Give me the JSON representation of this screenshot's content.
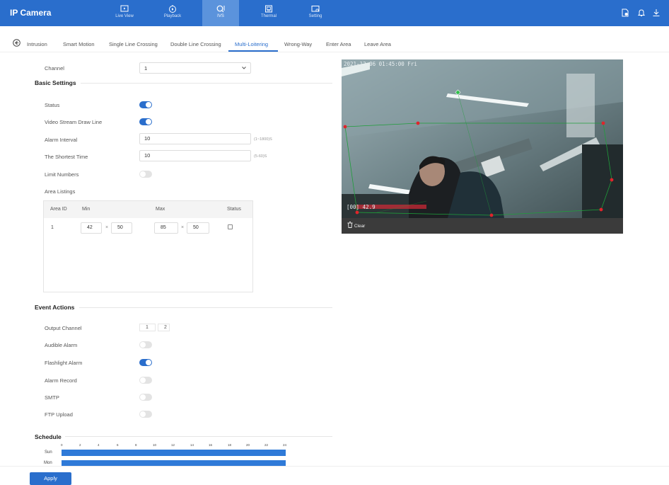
{
  "header": {
    "title": "IP Camera",
    "nav": [
      {
        "label": "Live View",
        "icon": "live-view-icon"
      },
      {
        "label": "Playback",
        "icon": "playback-icon"
      },
      {
        "label": "IVS",
        "icon": "ivs-icon"
      },
      {
        "label": "Thermal",
        "icon": "thermal-icon"
      },
      {
        "label": "Setting",
        "icon": "setting-icon"
      }
    ],
    "active_nav": "IVS"
  },
  "tabs": [
    "Intrusion",
    "Smart Motion",
    "Single Line Crossing",
    "Double Line Crossing",
    "Multi-Loitering",
    "Wrong-Way",
    "Enter Area",
    "Leave Area"
  ],
  "active_tab": "Multi-Loitering",
  "form": {
    "channel_label": "Channel",
    "channel_value": "1",
    "basic_settings": "Basic Settings",
    "status_label": "Status",
    "status_on": true,
    "draw_line_label": "Video Stream Draw Line",
    "draw_line_on": true,
    "alarm_interval_label": "Alarm Interval",
    "alarm_interval_value": "10",
    "alarm_interval_hint": "(1~1800)S",
    "shortest_time_label": "The Shortest Time",
    "shortest_time_value": "10",
    "shortest_time_hint": "(5-60)S",
    "limit_numbers_label": "Limit Numbers",
    "limit_numbers_on": false,
    "area_listings_label": "Area Listings"
  },
  "area_table": {
    "headers": [
      "Area ID",
      "Min",
      "Max",
      "Status"
    ],
    "rows": [
      {
        "id": "1",
        "min_w": "42",
        "min_h": "50",
        "max_w": "85",
        "max_h": "50",
        "times": "×"
      }
    ]
  },
  "events": {
    "title": "Event Actions",
    "output_channel_label": "Output Channel",
    "output_channels": [
      "1",
      "2"
    ],
    "audible_alarm_label": "Audible Alarm",
    "audible_alarm_on": false,
    "flashlight_alarm_label": "Flashlight Alarm",
    "flashlight_alarm_on": true,
    "alarm_record_label": "Alarm Record",
    "alarm_record_on": false,
    "smtp_label": "SMTP",
    "smtp_on": false,
    "ftp_label": "FTP Upload",
    "ftp_on": false
  },
  "schedule": {
    "title": "Schedule",
    "hours": [
      "0",
      "2",
      "4",
      "6",
      "8",
      "10",
      "12",
      "14",
      "16",
      "18",
      "20",
      "22",
      "24"
    ],
    "days": [
      "Sun",
      "Mon"
    ]
  },
  "apply_label": "Apply",
  "camera": {
    "timestamp": "2021-12-06 01:45:00 Fri",
    "osd_value": "[00] 42.9",
    "clear_label": "Clear"
  },
  "colors": {
    "accent": "#2a6ecc",
    "schedule_bar": "#2f7ad8",
    "region_point": "#e0242b",
    "region_line": "#1f9e3a"
  }
}
